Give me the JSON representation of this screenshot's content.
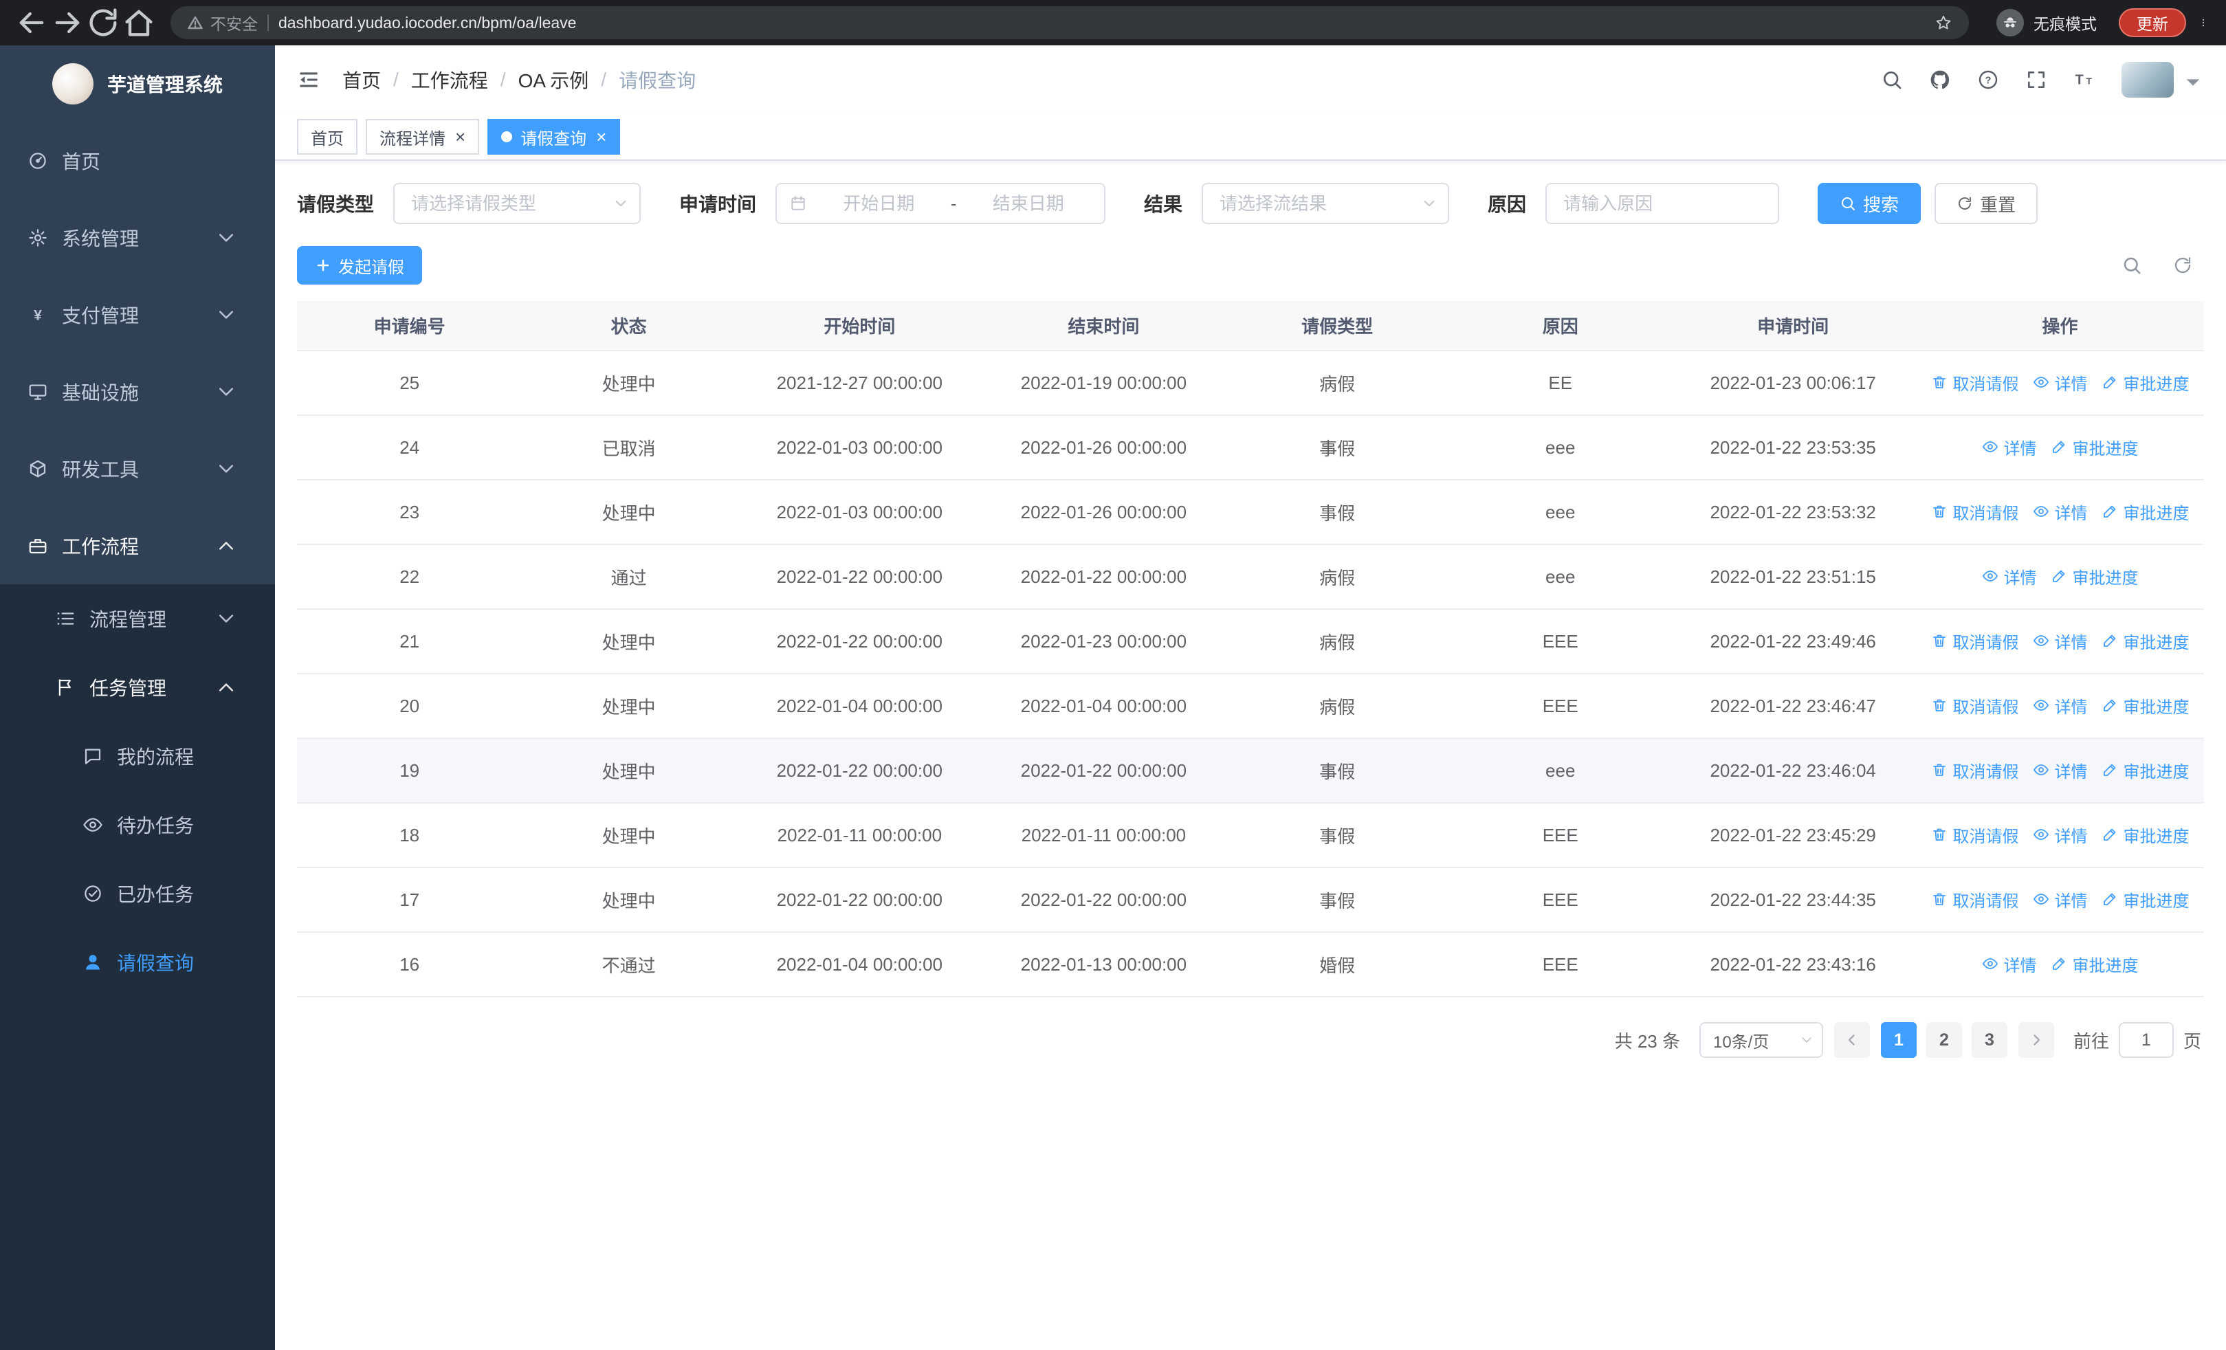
{
  "colors": {
    "primary": "#409eff",
    "sidebar_bg": "#304156",
    "submenu_bg": "#1f2d3d"
  },
  "browser": {
    "security_warning": "不安全",
    "url": "dashboard.yudao.iocoder.cn/bpm/oa/leave",
    "incognito_label": "无痕模式",
    "update_label": "更新"
  },
  "sidebar": {
    "logo_title": "芋道管理系统",
    "items": [
      {
        "key": "home",
        "label": "首页",
        "icon": "dashboard-icon",
        "level": 1
      },
      {
        "key": "system-mgmt",
        "label": "系统管理",
        "icon": "gear-icon",
        "level": 1,
        "arrow": "down"
      },
      {
        "key": "payment-mgmt",
        "label": "支付管理",
        "icon": "yen-icon",
        "level": 1,
        "arrow": "down"
      },
      {
        "key": "infrastructure",
        "label": "基础设施",
        "icon": "monitor-icon",
        "level": 1,
        "arrow": "down"
      },
      {
        "key": "dev-tools",
        "label": "研发工具",
        "icon": "cube-icon",
        "level": 1,
        "arrow": "down"
      },
      {
        "key": "workflow",
        "label": "工作流程",
        "icon": "briefcase-icon",
        "level": 1,
        "arrow": "up",
        "open": true
      },
      {
        "key": "process-mgmt",
        "label": "流程管理",
        "icon": "list-icon",
        "level": 2,
        "arrow": "down",
        "sub": true
      },
      {
        "key": "task-mgmt",
        "label": "任务管理",
        "icon": "flag-icon",
        "level": 2,
        "arrow": "up",
        "open": true,
        "sub": true
      },
      {
        "key": "my-process",
        "label": "我的流程",
        "icon": "chat-icon",
        "level": 3,
        "sub": true
      },
      {
        "key": "todo-tasks",
        "label": "待办任务",
        "icon": "eye-icon",
        "level": 3,
        "sub": true
      },
      {
        "key": "done-tasks",
        "label": "已办任务",
        "icon": "check-circle-icon",
        "level": 3,
        "sub": true
      },
      {
        "key": "leave-query",
        "label": "请假查询",
        "icon": "user-icon",
        "level": 3,
        "sub": true,
        "active": true
      }
    ]
  },
  "header": {
    "breadcrumb": [
      "首页",
      "工作流程",
      "OA 示例",
      "请假查询"
    ]
  },
  "tabs": [
    {
      "key": "home",
      "label": "首页"
    },
    {
      "key": "process-detail",
      "label": "流程详情",
      "closable": true
    },
    {
      "key": "leave-query",
      "label": "请假查询",
      "closable": true,
      "active": true
    }
  ],
  "filters": {
    "leave_type_label": "请假类型",
    "leave_type_placeholder": "请选择请假类型",
    "apply_time_label": "申请时间",
    "start_placeholder": "开始日期",
    "range_separator": "-",
    "end_placeholder": "结束日期",
    "result_label": "结果",
    "result_placeholder": "请选择流结果",
    "reason_label": "原因",
    "reason_placeholder": "请输入原因",
    "search_label": "搜索",
    "reset_label": "重置"
  },
  "toolbar": {
    "create_label": "发起请假"
  },
  "table": {
    "columns": [
      "申请编号",
      "状态",
      "开始时间",
      "结束时间",
      "请假类型",
      "原因",
      "申请时间",
      "操作"
    ],
    "action_labels": {
      "cancel": "取消请假",
      "detail": "详情",
      "progress": "审批进度"
    },
    "rows": [
      {
        "id": "25",
        "status": "处理中",
        "start": "2021-12-27 00:00:00",
        "end": "2022-01-19 00:00:00",
        "type": "病假",
        "reason": "EE",
        "apply_time": "2022-01-23 00:06:17",
        "actions": [
          "cancel",
          "detail",
          "progress"
        ]
      },
      {
        "id": "24",
        "status": "已取消",
        "start": "2022-01-03 00:00:00",
        "end": "2022-01-26 00:00:00",
        "type": "事假",
        "reason": "eee",
        "apply_time": "2022-01-22 23:53:35",
        "actions": [
          "detail",
          "progress"
        ]
      },
      {
        "id": "23",
        "status": "处理中",
        "start": "2022-01-03 00:00:00",
        "end": "2022-01-26 00:00:00",
        "type": "事假",
        "reason": "eee",
        "apply_time": "2022-01-22 23:53:32",
        "actions": [
          "cancel",
          "detail",
          "progress"
        ]
      },
      {
        "id": "22",
        "status": "通过",
        "start": "2022-01-22 00:00:00",
        "end": "2022-01-22 00:00:00",
        "type": "病假",
        "reason": "eee",
        "apply_time": "2022-01-22 23:51:15",
        "actions": [
          "detail",
          "progress"
        ]
      },
      {
        "id": "21",
        "status": "处理中",
        "start": "2022-01-22 00:00:00",
        "end": "2022-01-23 00:00:00",
        "type": "病假",
        "reason": "EEE",
        "apply_time": "2022-01-22 23:49:46",
        "actions": [
          "cancel",
          "detail",
          "progress"
        ]
      },
      {
        "id": "20",
        "status": "处理中",
        "start": "2022-01-04 00:00:00",
        "end": "2022-01-04 00:00:00",
        "type": "病假",
        "reason": "EEE",
        "apply_time": "2022-01-22 23:46:47",
        "actions": [
          "cancel",
          "detail",
          "progress"
        ]
      },
      {
        "id": "19",
        "status": "处理中",
        "start": "2022-01-22 00:00:00",
        "end": "2022-01-22 00:00:00",
        "type": "事假",
        "reason": "eee",
        "apply_time": "2022-01-22 23:46:04",
        "actions": [
          "cancel",
          "detail",
          "progress"
        ],
        "highlighted": true
      },
      {
        "id": "18",
        "status": "处理中",
        "start": "2022-01-11 00:00:00",
        "end": "2022-01-11 00:00:00",
        "type": "事假",
        "reason": "EEE",
        "apply_time": "2022-01-22 23:45:29",
        "actions": [
          "cancel",
          "detail",
          "progress"
        ]
      },
      {
        "id": "17",
        "status": "处理中",
        "start": "2022-01-22 00:00:00",
        "end": "2022-01-22 00:00:00",
        "type": "事假",
        "reason": "EEE",
        "apply_time": "2022-01-22 23:44:35",
        "actions": [
          "cancel",
          "detail",
          "progress"
        ]
      },
      {
        "id": "16",
        "status": "不通过",
        "start": "2022-01-04 00:00:00",
        "end": "2022-01-13 00:00:00",
        "type": "婚假",
        "reason": "EEE",
        "apply_time": "2022-01-22 23:43:16",
        "actions": [
          "detail",
          "progress"
        ]
      }
    ]
  },
  "pagination": {
    "total_text": "共 23 条",
    "page_size_label": "10条/页",
    "pages": [
      "1",
      "2",
      "3"
    ],
    "active_page": "1",
    "goto_label": "前往",
    "goto_value": "1",
    "goto_unit": "页"
  }
}
